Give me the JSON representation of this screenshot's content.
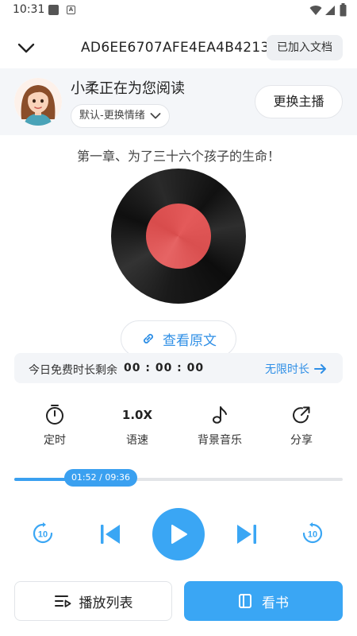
{
  "status_bar": {
    "time": "10:31"
  },
  "header": {
    "title": "AD6EE6707AFE4EA4B4213",
    "added_label": "已加入文档"
  },
  "narrator": {
    "status_text": "小柔正在为您阅读",
    "emotion_label": "默认-更换情绪",
    "switch_label": "更换主播"
  },
  "chapter_title": "第一章、为了三十六个孩子的生命！",
  "original_text_label": "查看原文",
  "free_time": {
    "label": "今日免费时长剩余",
    "time": "00 : 00 : 00",
    "unlimited_label": "无限时长"
  },
  "tools": [
    {
      "icon": "timer-icon",
      "label": "定时"
    },
    {
      "icon": "speed-icon",
      "value": "1.0X",
      "label": "语速"
    },
    {
      "icon": "music-note-icon",
      "label": "背景音乐"
    },
    {
      "icon": "share-icon",
      "label": "分享"
    }
  ],
  "progress": {
    "current": "01:52",
    "total": "09:36",
    "display": "01:52 / 09:36",
    "fraction": 0.19
  },
  "controls": {
    "rewind": "10",
    "forward": "10"
  },
  "bottom": {
    "playlist_label": "播放列表",
    "read_label": "看书"
  },
  "colors": {
    "accent": "#3aa6f4",
    "link": "#2f8fe6",
    "record_label": "#e45a5a"
  }
}
